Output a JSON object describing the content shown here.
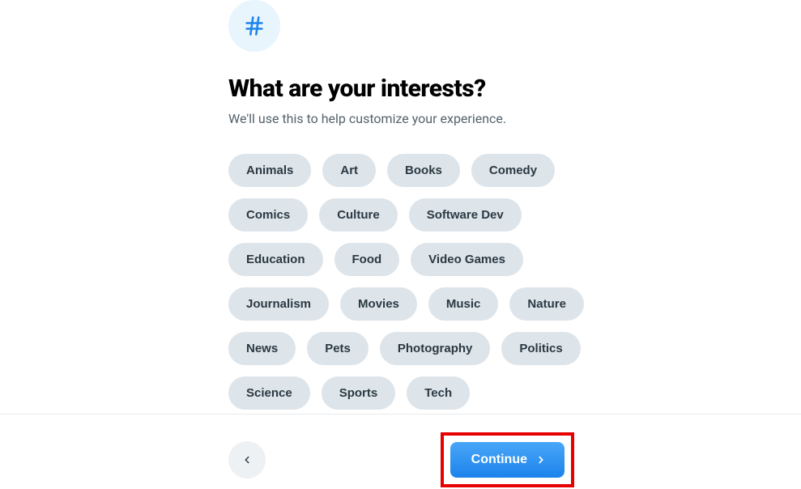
{
  "header": {
    "icon_name": "hashtag-icon",
    "title": "What are your interests?",
    "subtitle": "We'll use this to help customize your experience."
  },
  "interests": [
    "Animals",
    "Art",
    "Books",
    "Comedy",
    "Comics",
    "Culture",
    "Software Dev",
    "Education",
    "Food",
    "Video Games",
    "Journalism",
    "Movies",
    "Music",
    "Nature",
    "News",
    "Pets",
    "Photography",
    "Politics",
    "Science",
    "Sports",
    "Tech"
  ],
  "footer": {
    "back_label": "Back",
    "continue_label": "Continue"
  },
  "colors": {
    "accent_blue": "#1d83ec",
    "accent_blue_light": "#49a6f8",
    "chip_bg": "#dde4ea",
    "chip_text": "#2b3942",
    "subtitle_text": "#53626c",
    "hash_bg": "#e8f5fd",
    "highlight_border": "#e60000"
  }
}
